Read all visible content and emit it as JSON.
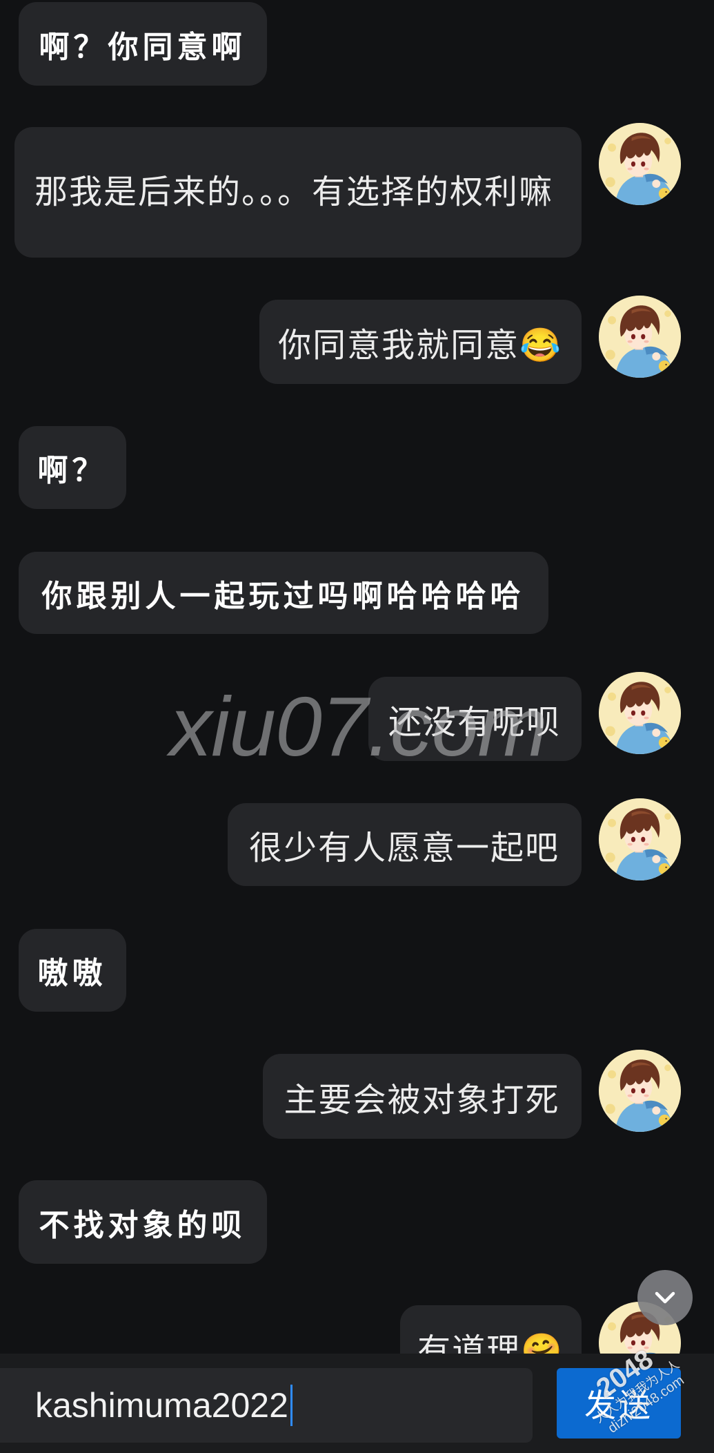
{
  "chat": {
    "messages": [
      {
        "outgoing": false,
        "text": "啊？你同意啊"
      },
      {
        "outgoing": true,
        "text": "那我是后来的。。。有选择的权利嘛"
      },
      {
        "outgoing": true,
        "text": "你同意我就同意😂"
      },
      {
        "outgoing": false,
        "text": "啊？"
      },
      {
        "outgoing": false,
        "text": "你跟别人一起玩过吗啊哈哈哈哈"
      },
      {
        "outgoing": true,
        "text": "还没有呢呗"
      },
      {
        "outgoing": true,
        "text": "很少有人愿意一起吧"
      },
      {
        "outgoing": false,
        "text": "嗷嗷"
      },
      {
        "outgoing": true,
        "text": "主要会被对象打死"
      },
      {
        "outgoing": false,
        "text": "不找对象的呗"
      },
      {
        "outgoing": true,
        "text": "有道理🤗"
      }
    ],
    "avatar_icon": "cartoon-boy-avatar-icon",
    "scroll_down_icon": "chevron-down-icon"
  },
  "composer": {
    "input_value": "kashimuma2022",
    "send_label": "发送"
  },
  "watermarks": {
    "site": "xiu07.com",
    "badge_number": "2048",
    "badge_slogan": "人人为我我为人人",
    "badge_url": "dizhi2048.com"
  },
  "colors": {
    "background": "#111214",
    "bubble": "#252629",
    "composer_bar": "#1b1c1e",
    "input_field": "#27282b",
    "send_button": "#0c6ad0",
    "caret": "#2f8cff",
    "text": "#ececec"
  }
}
